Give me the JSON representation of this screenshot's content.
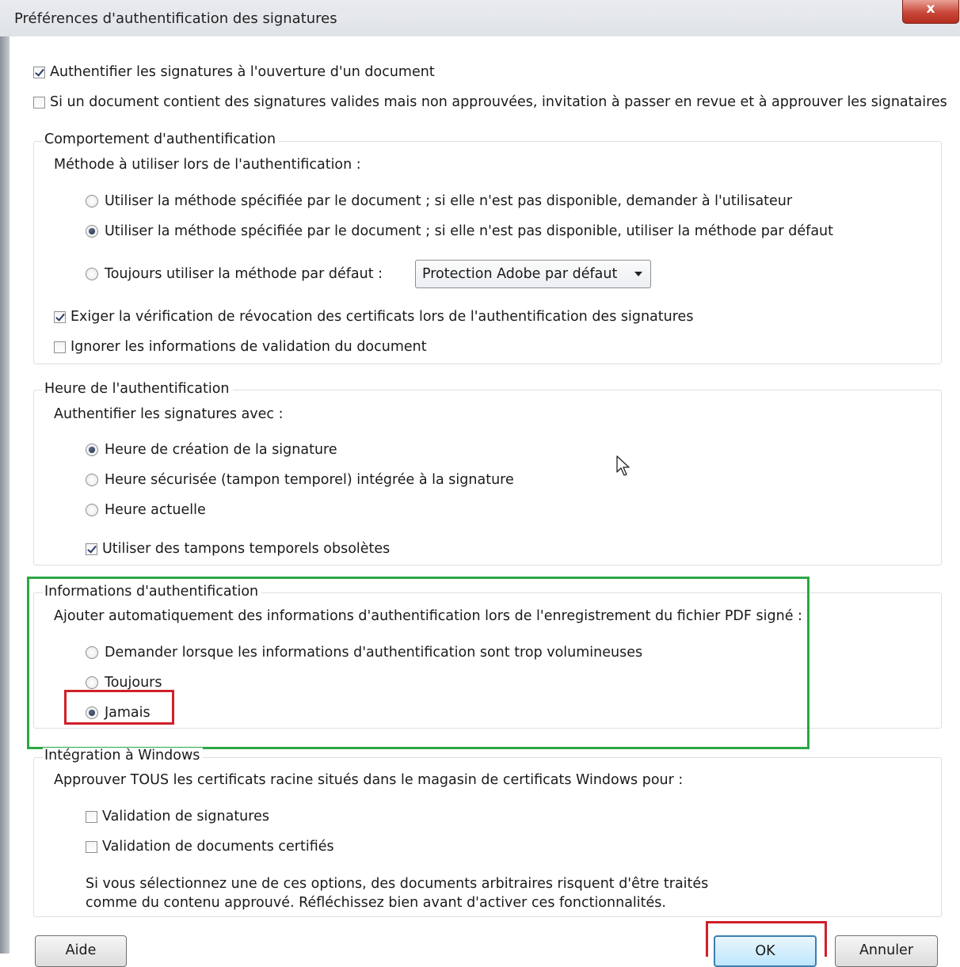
{
  "window": {
    "title": "Préférences d'authentification des signatures",
    "close_label": "x"
  },
  "top_options": [
    {
      "label": "Authentifier les signatures à l'ouverture d'un document",
      "checked": true
    },
    {
      "label": "Si un document contient des signatures valides mais non approuvées, invitation à passer en revue et à approuver les signataires",
      "checked": false
    }
  ],
  "auth_behavior": {
    "legend": "Comportement d'authentification",
    "method_label": "Méthode à utiliser lors de l'authentification :",
    "radios": [
      {
        "label": "Utiliser la méthode spécifiée par le document ; si elle n'est pas disponible, demander à l'utilisateur",
        "selected": false
      },
      {
        "label": "Utiliser la méthode spécifiée par le document ; si elle n'est pas disponible, utiliser la méthode par défaut",
        "selected": true
      },
      {
        "label": "Toujours utiliser la méthode par défaut :",
        "selected": false
      }
    ],
    "default_method_value": "Protection Adobe par défaut",
    "checkboxes": [
      {
        "label": "Exiger la vérification de révocation des certificats lors de l'authentification des signatures",
        "checked": true
      },
      {
        "label": "Ignorer les informations de validation du document",
        "checked": false
      }
    ]
  },
  "auth_time": {
    "legend": "Heure de l'authentification",
    "intro": "Authentifier les signatures avec :",
    "radios": [
      {
        "label": "Heure de création de la signature",
        "selected": true
      },
      {
        "label": "Heure sécurisée (tampon temporel) intégrée à la signature",
        "selected": false
      },
      {
        "label": "Heure actuelle",
        "selected": false
      }
    ],
    "checkbox": {
      "label": "Utiliser des tampons temporels obsolètes",
      "checked": true
    }
  },
  "auth_info": {
    "legend": "Informations d'authentification",
    "intro": "Ajouter automatiquement des informations d'authentification lors de l'enregistrement du fichier PDF signé :",
    "radios": [
      {
        "label": "Demander lorsque les informations d'authentification sont trop volumineuses",
        "selected": false
      },
      {
        "label": "Toujours",
        "selected": false
      },
      {
        "label": "Jamais",
        "selected": true
      }
    ]
  },
  "windows_integration": {
    "legend": "Intégration à Windows",
    "intro": "Approuver TOUS les certificats racine situés dans le magasin de certificats Windows pour :",
    "checkboxes": [
      {
        "label": "Validation de signatures",
        "checked": false
      },
      {
        "label": "Validation de documents certifiés",
        "checked": false
      }
    ],
    "warning_line1": "Si vous sélectionnez une de ces options, des documents arbitraires risquent d'être traités",
    "warning_line2": "comme du contenu approuvé. Réfléchissez bien avant d'activer ces fonctionnalités."
  },
  "buttons": {
    "help": "Aide",
    "ok": "OK",
    "cancel": "Annuler"
  },
  "colors": {
    "highlight_green": "#2aa744",
    "highlight_red": "#d0202a",
    "title_close": "#c9473a"
  }
}
